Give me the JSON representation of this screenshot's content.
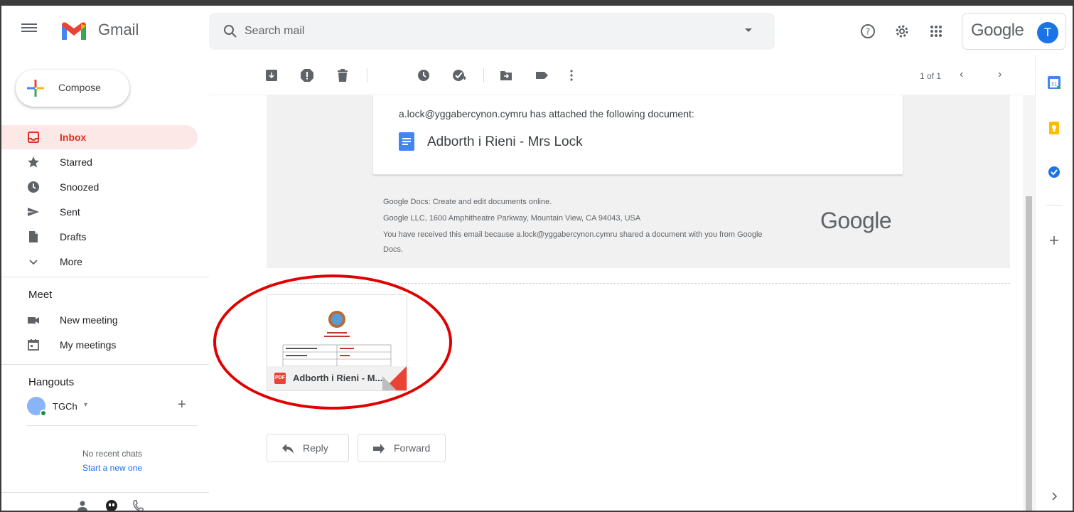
{
  "header": {
    "app_name": "Gmail",
    "search_placeholder": "Search mail",
    "account_brand": "Google",
    "avatar_initial": "T",
    "icons": [
      "main-menu-icon",
      "gmail-logo-icon",
      "search-icon",
      "search-options-icon",
      "help-icon",
      "settings-icon",
      "apps-grid-icon"
    ]
  },
  "sidebar": {
    "compose_label": "Compose",
    "items": [
      {
        "label": "Inbox",
        "icon": "inbox-icon",
        "active": true
      },
      {
        "label": "Starred",
        "icon": "star-icon"
      },
      {
        "label": "Snoozed",
        "icon": "clock-icon"
      },
      {
        "label": "Sent",
        "icon": "send-icon"
      },
      {
        "label": "Drafts",
        "icon": "draft-icon"
      },
      {
        "label": "More",
        "icon": "chevron-down-icon"
      }
    ],
    "meet": {
      "title": "Meet",
      "items": [
        {
          "label": "New meeting",
          "icon": "video-camera-icon"
        },
        {
          "label": "My meetings",
          "icon": "calendar-icon"
        }
      ]
    },
    "hangouts": {
      "title": "Hangouts",
      "user": "TGCh",
      "no_chats": "No recent chats",
      "start_new": "Start a new one"
    }
  },
  "toolbar": {
    "icons": [
      "archive-icon",
      "report-spam-icon",
      "delete-icon",
      "snooze-icon",
      "add-to-tasks-icon",
      "move-to-icon",
      "label-icon",
      "more-vert-icon"
    ],
    "pager": "1 of 1"
  },
  "email": {
    "attached_text": "a.lock@yggabercynon.cymru has attached the following document:",
    "doc_title": "Adborth i Rieni - Mrs Lock",
    "footer_lines": [
      "Google Docs: Create and edit documents online.",
      "Google LLC, 1600 Amphitheatre Parkway, Mountain View, CA 94043, USA",
      "You have received this email because a.lock@yggabercynon.cymru shared a document with you from Google",
      "Docs."
    ],
    "footer_logo": "Google",
    "attachment_name": "Adborth i Rieni - M...",
    "attachment_type": "PDF",
    "preview_rows": [
      "Enw'r Plentyn / Name of Child",
      "Dosbarth / Class",
      "Mrs A Lock",
      "Aspen"
    ],
    "reply_label": "Reply",
    "forward_label": "Forward"
  },
  "colors": {
    "accent_red": "#d93025",
    "link_blue": "#1a73e8",
    "annotation_red": "#e00000"
  }
}
